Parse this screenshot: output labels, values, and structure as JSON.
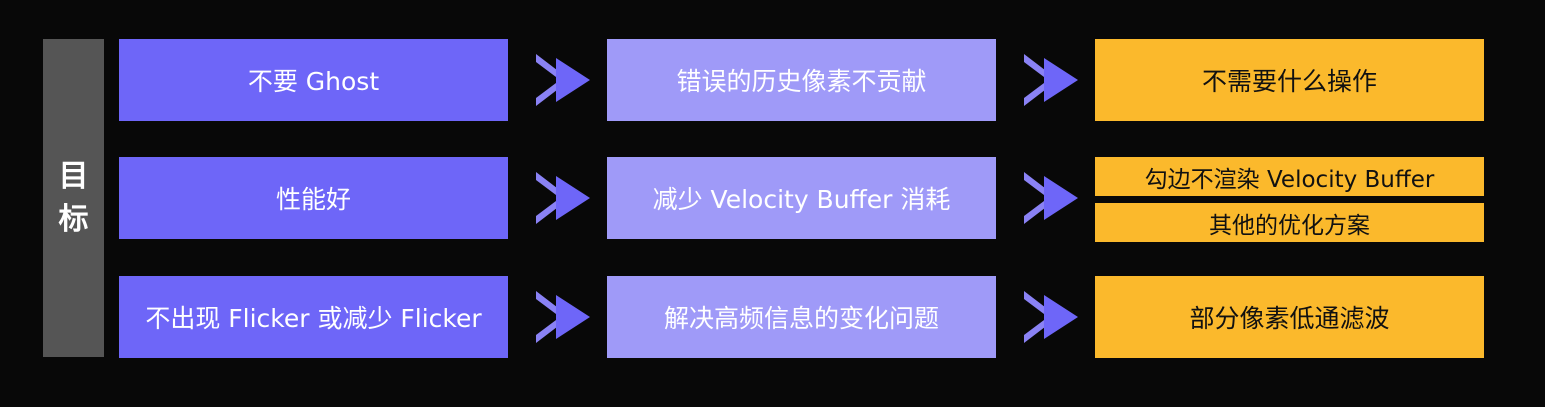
{
  "side_label": [
    "目",
    "标"
  ],
  "rows": [
    {
      "goal": "不要 Ghost",
      "approach": "错误的历史像素不贡献",
      "actions": [
        "不需要什么操作"
      ]
    },
    {
      "goal": "性能好",
      "approach": "减少 Velocity Buffer 消耗",
      "actions": [
        "勾边不渲染 Velocity Buffer",
        "其他的优化方案"
      ]
    },
    {
      "goal": "不出现 Flicker 或减少 Flicker",
      "approach": "解决高频信息的变化问题",
      "actions": [
        "部分像素低通滤波"
      ]
    }
  ],
  "colors": {
    "background": "#080808",
    "side": "#555555",
    "goal": "#6e66f8",
    "approach": "#9f9af8",
    "action": "#fbb92c",
    "arrow": "#8a82f5"
  }
}
